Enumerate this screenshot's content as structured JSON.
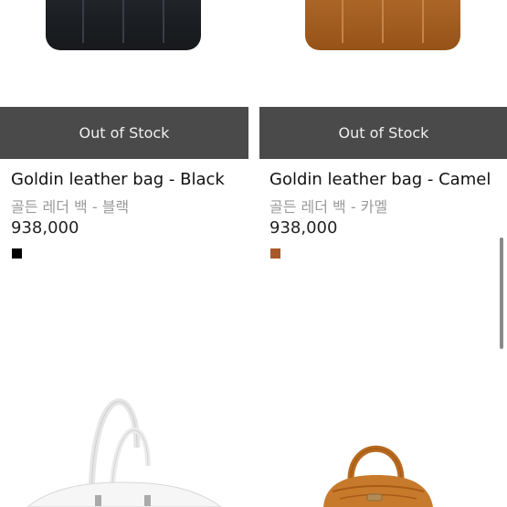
{
  "products": [
    {
      "title": "Goldin leather bag - Black",
      "subtitle": "골든 레더 백 - 블랙",
      "price": "938,000",
      "status": "Out of Stock",
      "swatch_color": "#000000",
      "bag_color": "black"
    },
    {
      "title": "Goldin leather bag - Camel",
      "subtitle": "골든 레더 백 - 카멜",
      "price": "938,000",
      "status": "Out of Stock",
      "swatch_color": "#a8582a",
      "bag_color": "camel"
    }
  ],
  "next_row": [
    {
      "bag_color": "white"
    },
    {
      "bag_color": "camel"
    }
  ]
}
